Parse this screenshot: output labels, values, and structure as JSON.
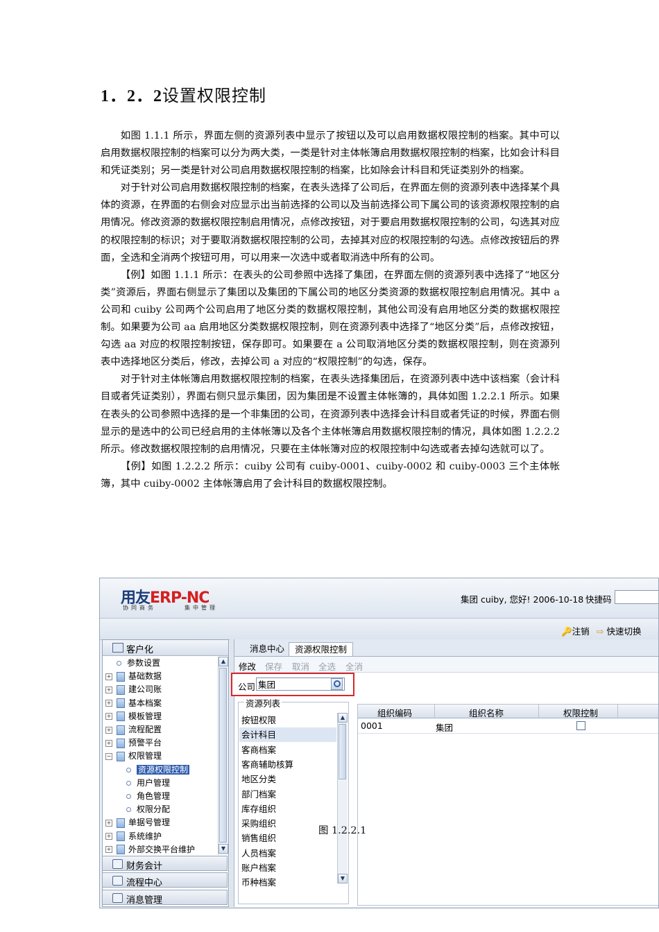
{
  "heading": {
    "number": "1．2．2",
    "title": "设置权限控制"
  },
  "paragraphs": [
    "如图 1.1.1 所示，界面左侧的资源列表中显示了按钮以及可以启用数据权限控制的档案。其中可以启用数据权限控制的档案可以分为两大类，一类是针对主体帐簿启用数据权限控制的档案，比如会计科目和凭证类别；另一类是针对公司启用数据权限控制的档案，比如除会计科目和凭证类别外的档案。",
    "对于针对公司启用数据权限控制的档案，在表头选择了公司后，在界面左侧的资源列表中选择某个具体的资源，在界面的右侧会对应显示出当前选择的公司以及当前选择公司下属公司的该资源权限控制的启用情况。修改资源的数据权限控制启用情况，点修改按钮，对于要启用数据权限控制的公司，勾选其对应的权限控制的标识；对于要取消数据权限控制的公司，去掉其对应的权限控制的勾选。点修改按钮后的界面，全选和全消两个按钮可用，可以用来一次选中或者取消选中所有的公司。",
    "【例】如图 1.1.1 所示：在表头的公司参照中选择了集团，在界面左侧的资源列表中选择了“地区分类”资源后，界面右侧显示了集团以及集团的下属公司的地区分类资源的数据权限控制启用情况。其中 a 公司和 cuiby 公司两个公司启用了地区分类的数据权限控制，其他公司没有启用地区分类的数据权限控制。如果要为公司 aa 启用地区分类数据权限控制，则在资源列表中选择了“地区分类”后，点修改按钮，勾选 aa 对应的权限控制按钮，保存即可。如果要在 a 公司取消地区分类的数据权限控制，则在资源列表中选择地区分类后，修改，去掉公司 a 对应的“权限控制”的勾选，保存。",
    "对于针对主体帐簿启用数据权限控制的档案，在表头选择集团后，在资源列表中选中该档案（会计科目或者凭证类别），界面右侧只显示集团，因为集团是不设置主体帐簿的，具体如图 1.2.2.1 所示。如果在表头的公司参照中选择的是一个非集团的公司，在资源列表中选择会计科目或者凭证的时候，界面右侧显示的是选中的公司已经启用的主体帐簿以及各个主体帐簿启用数据权限控制的情况，具体如图 1.2.2.2 所示。修改数据权限控制的启用情况，只要在主体帐簿对应的权限控制中勾选或者去掉勾选就可以了。",
    "【例】如图 1.2.2.2 所示：cuiby 公司有 cuiby-0001、cuiby-0002 和 cuiby-0003 三个主体帐簿，其中 cuiby-0002 主体帐簿启用了会计科目的数据权限控制。"
  ],
  "app": {
    "logo_main": "用友",
    "logo_erp": "ERP-NC",
    "logo_sub_left": "协同商务",
    "logo_sub_right": "集中管理",
    "greeting": "集团 cuiby, 您好! 2006-10-18",
    "quick_code_label": "快捷码",
    "logout_label": "注销",
    "quick_switch_label": "快速切换",
    "left_panel_title": "客户化",
    "tree": [
      {
        "label": "参数设置",
        "kind": "leaf"
      },
      {
        "label": "基础数据",
        "kind": "folder"
      },
      {
        "label": "建公司账",
        "kind": "folder"
      },
      {
        "label": "基本档案",
        "kind": "folder"
      },
      {
        "label": "模板管理",
        "kind": "folder"
      },
      {
        "label": "流程配置",
        "kind": "folder"
      },
      {
        "label": "预警平台",
        "kind": "folder"
      },
      {
        "label": "权限管理",
        "kind": "open"
      },
      {
        "label": "资源权限控制",
        "kind": "child",
        "selected": true
      },
      {
        "label": "用户管理",
        "kind": "child"
      },
      {
        "label": "角色管理",
        "kind": "child"
      },
      {
        "label": "权限分配",
        "kind": "child"
      },
      {
        "label": "单据号管理",
        "kind": "folder"
      },
      {
        "label": "系统维护",
        "kind": "folder"
      },
      {
        "label": "外部交换平台维护",
        "kind": "folder"
      }
    ],
    "accordion": [
      "财务会计",
      "流程中心",
      "消息管理"
    ],
    "tabs": [
      "消息中心",
      "资源权限控制"
    ],
    "actions": [
      "修改",
      "保存",
      "取消",
      "全选",
      "全消"
    ],
    "company_label": "公司",
    "company_value": "集团",
    "resource_list_title": "资源列表",
    "resources": [
      "按钮权限",
      "会计科目",
      "客商档案",
      "客商辅助核算",
      "地区分类",
      "部门档案",
      "库存组织",
      "采购组织",
      "销售组织",
      "人员档案",
      "账户档案",
      "币种档案"
    ],
    "table_headers": [
      "组织编码",
      "组织名称",
      "权限控制"
    ],
    "table_rows": [
      {
        "code": "0001",
        "name": "集团",
        "checked": false
      }
    ]
  },
  "caption": "图 1.2.2.1"
}
